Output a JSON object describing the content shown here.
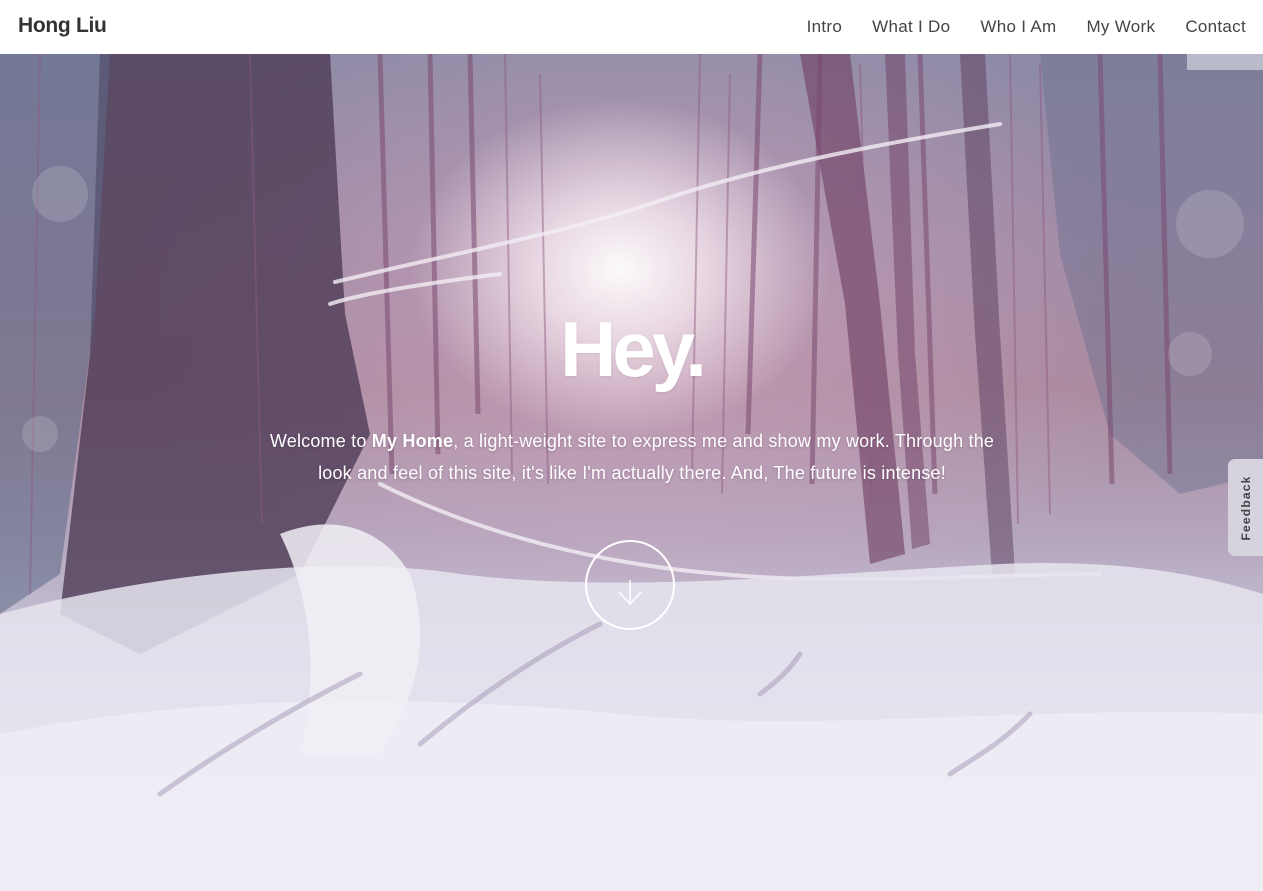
{
  "header": {
    "brand": "Hong Liu",
    "nav": [
      {
        "label": "Intro"
      },
      {
        "label": "What I Do"
      },
      {
        "label": "Who I Am"
      },
      {
        "label": "My Work"
      },
      {
        "label": "Contact"
      }
    ]
  },
  "hero": {
    "title": "Hey.",
    "text_before": "Welcome to ",
    "text_strong": "My Home",
    "text_after": ", a light-weight site to express me and show my work. Through the look and feel of this site, it's like I'm actually there. And, The future is intense!",
    "scroll_icon": "arrow-down-icon"
  },
  "feedback": {
    "label": "Feedback"
  },
  "colors": {
    "header_bg": "#ffffff",
    "brand_text": "#333333",
    "nav_text": "#444444",
    "hero_text": "#ffffff",
    "feedback_bg": "#d6d3de"
  }
}
